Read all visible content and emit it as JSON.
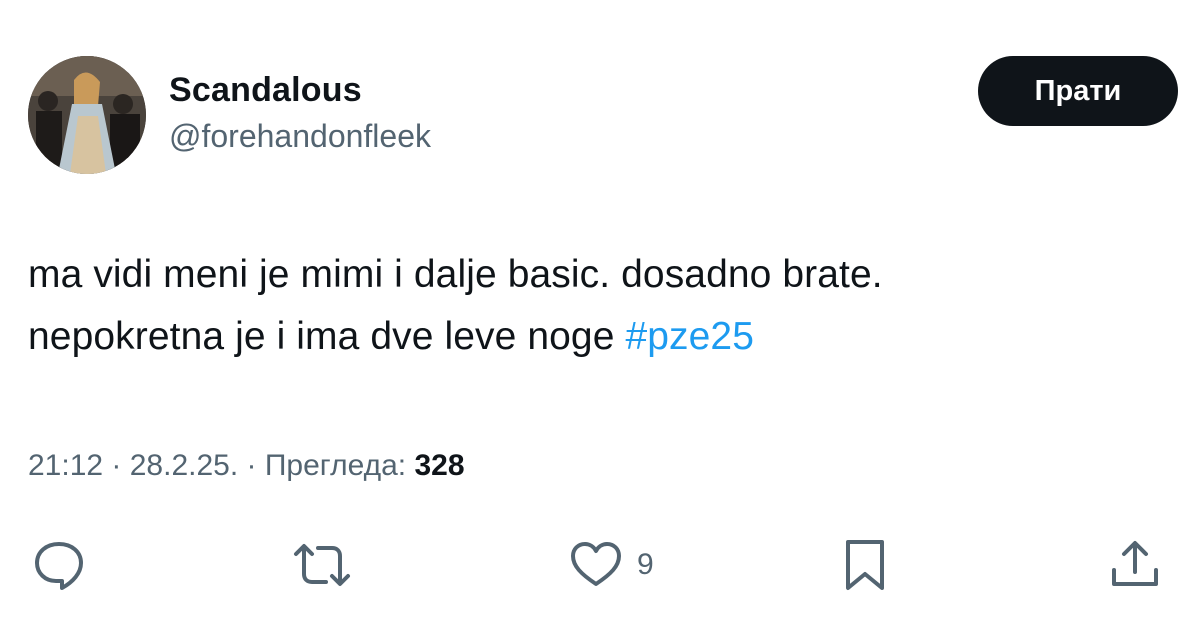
{
  "author": {
    "display_name": "Scandalous",
    "handle": "@forehandonfleek"
  },
  "follow_label": "Прати",
  "tweet": {
    "text": "ma vidi meni je mimi i dalje basic. dosadno brate.",
    "text_line2": "nepokretna je i ima dve leve noge",
    "hashtag": "#pze25"
  },
  "meta": {
    "time": "21:12",
    "date": "28.2.25.",
    "views_label": "Прегледа:",
    "views_count": "328"
  },
  "actions": {
    "like_count": "9"
  },
  "icons": {
    "reply": "reply-icon",
    "retweet": "retweet-icon",
    "like": "heart-icon",
    "bookmark": "bookmark-icon",
    "share": "share-icon"
  },
  "colors": {
    "text": "#0f1419",
    "secondary": "#536471",
    "hashtag": "#1d9bf0",
    "follow_bg": "#0f1419"
  }
}
